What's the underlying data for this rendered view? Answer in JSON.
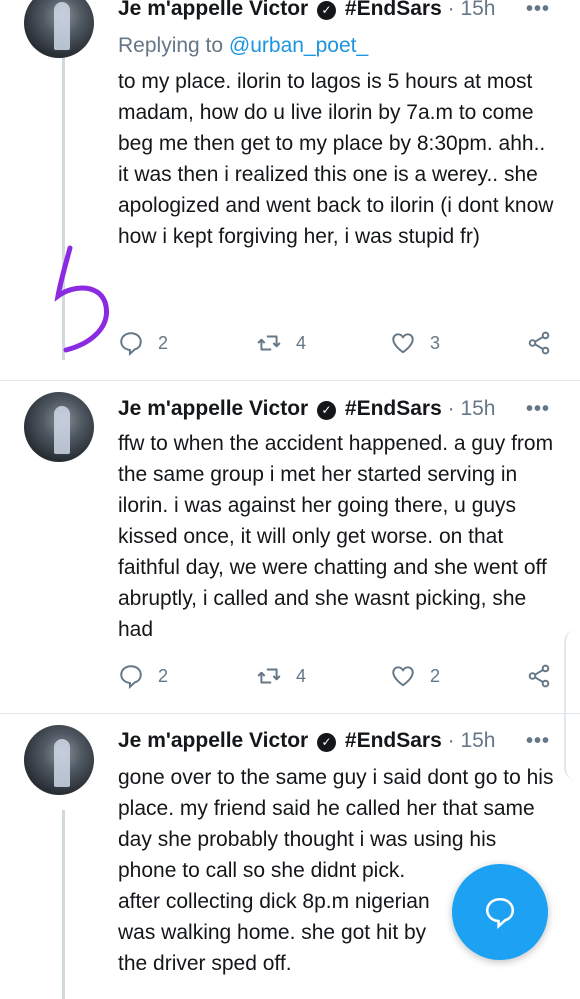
{
  "tweets": [
    {
      "author": "Je m'appelle Victor",
      "tag": "#EndSars",
      "time": "15h",
      "replying_label": "Replying to",
      "replying_handle": "@urban_poet_",
      "lines": [
        "to my place. ilorin to lagos is 5 hours at most madam, how do u live ilorin by 7a.m to come beg me then get to my place by 8:30pm. ahh..",
        "it was then i realized this one is a werey.. she apologized and went back to ilorin (i dont know how i kept forgiving her, i was stupid fr)"
      ],
      "replies": "2",
      "retweets": "4",
      "likes": "3"
    },
    {
      "author": "Je m'appelle Victor",
      "tag": "#EndSars",
      "time": "15h",
      "lines": [
        "ffw to when the accident happened. a guy from the same group i met her started serving in ilorin. i was against her going there, u guys kissed once, it will only get worse. on that faithful day, we were chatting and she went off abruptly, i called and she wasnt picking, she had"
      ],
      "replies": "2",
      "retweets": "4",
      "likes": "2"
    },
    {
      "author": "Je m'appelle Victor",
      "tag": "#EndSars",
      "time": "15h",
      "lines": [
        "gone over to the same guy i said dont go to his place. my friend said he called her that same day she probably thought i was using his phone to call so she didnt pick.",
        "after collecting dick 8p.m nigerian",
        "was walking home. she got hit by",
        "the driver sped off."
      ]
    }
  ],
  "icons": {
    "reply": "speech-bubble",
    "retweet": "retweet-arrows",
    "like": "heart",
    "share": "share-nodes",
    "more": "ellipsis",
    "compose": "speech-bubble"
  },
  "colors": {
    "accent": "#1da1f2",
    "mention": "#1b95e0",
    "muted": "#657786",
    "doodle": "#8a2be2"
  }
}
